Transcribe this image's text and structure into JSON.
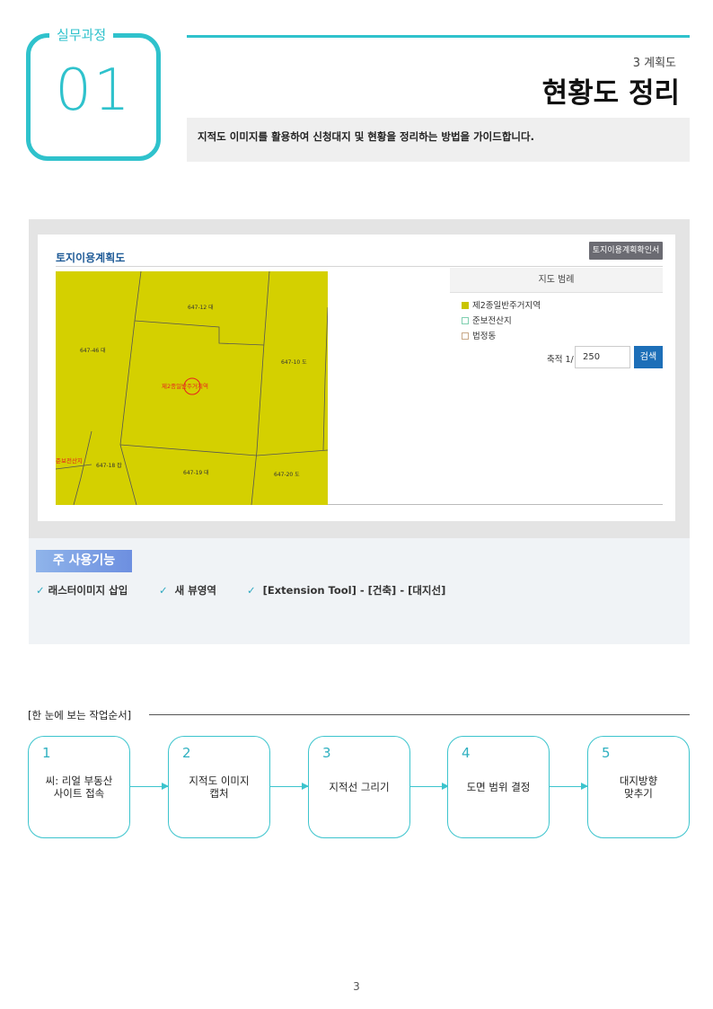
{
  "header": {
    "badge_label": "실무과정",
    "badge_number": "01",
    "chapter": "3 계획도",
    "title": "현황도 정리",
    "subtitle": "지적도 이미지를 활용하여 신청대지 및 현황을 정리하는 방법을 가이드합니다."
  },
  "screenshot": {
    "panel_title": "토지이용계획도",
    "confirm_button": "토지이용계획확인서",
    "legend_title": "지도 범례",
    "legend_items": [
      {
        "label": "제2종일반주거지역",
        "color": "#c9c400"
      },
      {
        "label": "준보전산지",
        "color": "#bfe8d8"
      },
      {
        "label": "법정동",
        "color": "#f0e6dc"
      }
    ],
    "scale_label": "축적 1/",
    "scale_value": "250",
    "search_button": "검색",
    "map": {
      "fill_color": "#d4d000",
      "parcels": [
        "647-12 대",
        "647-46 대",
        "647-10 도",
        "647-18 잡",
        "647-19 대",
        "647-20 도"
      ],
      "zone_label": "제2종일반주거지역",
      "side_label": "준보전산지"
    }
  },
  "functions": {
    "title": "주 사용기능",
    "items": [
      "래스터이미지 삽입",
      "새 뷰영역",
      "[Extension Tool] - [건축] - [대지선]"
    ]
  },
  "workflow": {
    "title": "[한 눈에 보는 작업순서]",
    "steps": [
      {
        "num": "1",
        "label": "씨: 리얼 부동산\n사이트 접속"
      },
      {
        "num": "2",
        "label": "지적도 이미지\n캡처"
      },
      {
        "num": "3",
        "label": "지적선 그리기"
      },
      {
        "num": "4",
        "label": "도면 범위 결정"
      },
      {
        "num": "5",
        "label": "대지방향\n맞추기"
      }
    ]
  },
  "page_number": "3"
}
